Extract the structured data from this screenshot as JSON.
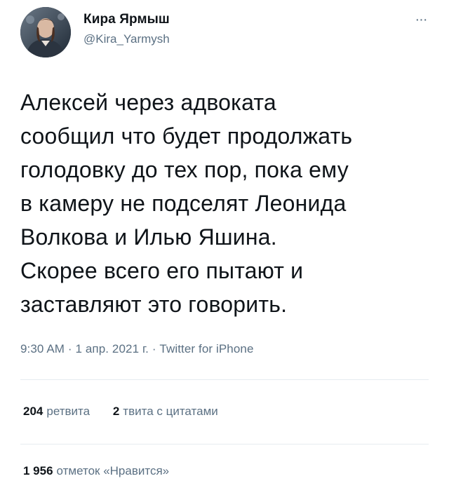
{
  "author": {
    "display_name": "Кира Ярмыш",
    "handle": "@Kira_Yarmysh"
  },
  "more_icon": "more-horizontal-icon",
  "tweet": {
    "text": "Алексей через адвоката\nсообщил что будет продолжать\nголодовку до тех пор, пока ему\nв камеру не подселят Леонида\nВолкова и Илью Яшина.\nСкорее всего его пытают и\nзаставляют это говорить.",
    "meta": "9:30 AM · 1 апр. 2021 г. · Twitter for iPhone"
  },
  "stats": {
    "retweets": {
      "count": "204",
      "label": "ретвита"
    },
    "quotes": {
      "count": "2",
      "label": "твита с цитатами"
    },
    "likes": {
      "count": "1 956",
      "label": "отметок «Нравится»"
    }
  },
  "colors": {
    "text": "#0f1419",
    "secondary": "#5b7083",
    "divider": "#e6ecf0"
  }
}
